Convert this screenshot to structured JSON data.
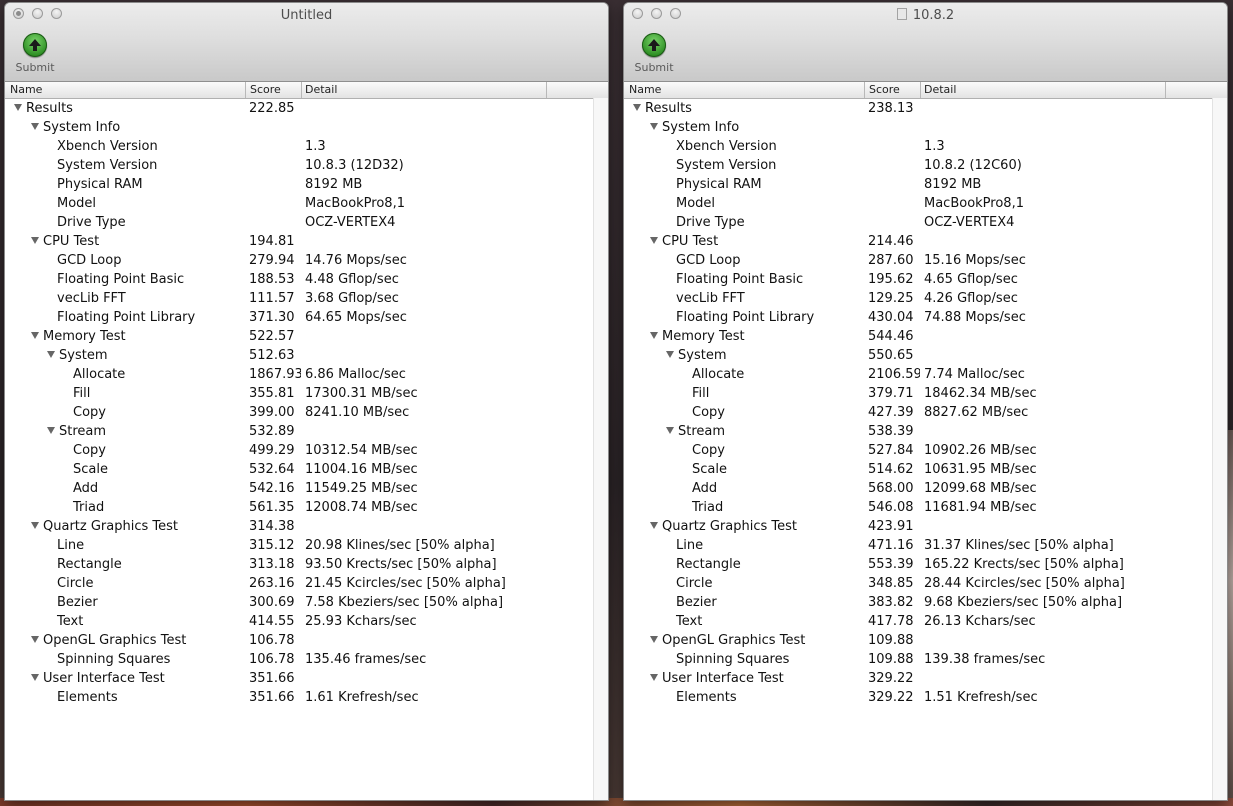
{
  "windows": [
    {
      "title": "Untitled",
      "has_doc_icon": false,
      "submit_label": "Submit",
      "columns": [
        "Name",
        "Score",
        "Detail"
      ],
      "rows": [
        {
          "level": 0,
          "name": "Results",
          "score": "222.85",
          "detail": "",
          "disclosure": true
        },
        {
          "level": 1,
          "name": "System Info",
          "score": "",
          "detail": "",
          "disclosure": true
        },
        {
          "level": 2,
          "name": "Xbench Version",
          "score": "",
          "detail": "1.3",
          "disclosure": false
        },
        {
          "level": 2,
          "name": "System Version",
          "score": "",
          "detail": "10.8.3 (12D32)",
          "disclosure": false
        },
        {
          "level": 2,
          "name": "Physical RAM",
          "score": "",
          "detail": "8192 MB",
          "disclosure": false
        },
        {
          "level": 2,
          "name": "Model",
          "score": "",
          "detail": "MacBookPro8,1",
          "disclosure": false
        },
        {
          "level": 2,
          "name": "Drive Type",
          "score": "",
          "detail": "OCZ-VERTEX4",
          "disclosure": false
        },
        {
          "level": 1,
          "name": "CPU Test",
          "score": "194.81",
          "detail": "",
          "disclosure": true
        },
        {
          "level": 2,
          "name": "GCD Loop",
          "score": "279.94",
          "detail": "14.76 Mops/sec",
          "disclosure": false
        },
        {
          "level": 2,
          "name": "Floating Point Basic",
          "score": "188.53",
          "detail": "4.48 Gflop/sec",
          "disclosure": false
        },
        {
          "level": 2,
          "name": "vecLib FFT",
          "score": "111.57",
          "detail": "3.68 Gflop/sec",
          "disclosure": false
        },
        {
          "level": 2,
          "name": "Floating Point Library",
          "score": "371.30",
          "detail": "64.65 Mops/sec",
          "disclosure": false
        },
        {
          "level": 1,
          "name": "Memory Test",
          "score": "522.57",
          "detail": "",
          "disclosure": true
        },
        {
          "level": 2,
          "name": "System",
          "score": "512.63",
          "detail": "",
          "disclosure": true
        },
        {
          "level": 3,
          "name": "Allocate",
          "score": "1867.93",
          "detail": "6.86 Malloc/sec",
          "disclosure": false
        },
        {
          "level": 3,
          "name": "Fill",
          "score": "355.81",
          "detail": "17300.31 MB/sec",
          "disclosure": false
        },
        {
          "level": 3,
          "name": "Copy",
          "score": "399.00",
          "detail": "8241.10 MB/sec",
          "disclosure": false
        },
        {
          "level": 2,
          "name": "Stream",
          "score": "532.89",
          "detail": "",
          "disclosure": true
        },
        {
          "level": 3,
          "name": "Copy",
          "score": "499.29",
          "detail": "10312.54 MB/sec",
          "disclosure": false
        },
        {
          "level": 3,
          "name": "Scale",
          "score": "532.64",
          "detail": "11004.16 MB/sec",
          "disclosure": false
        },
        {
          "level": 3,
          "name": "Add",
          "score": "542.16",
          "detail": "11549.25 MB/sec",
          "disclosure": false
        },
        {
          "level": 3,
          "name": "Triad",
          "score": "561.35",
          "detail": "12008.74 MB/sec",
          "disclosure": false
        },
        {
          "level": 1,
          "name": "Quartz Graphics Test",
          "score": "314.38",
          "detail": "",
          "disclosure": true
        },
        {
          "level": 2,
          "name": "Line",
          "score": "315.12",
          "detail": "20.98 Klines/sec [50% alpha]",
          "disclosure": false
        },
        {
          "level": 2,
          "name": "Rectangle",
          "score": "313.18",
          "detail": "93.50 Krects/sec [50% alpha]",
          "disclosure": false
        },
        {
          "level": 2,
          "name": "Circle",
          "score": "263.16",
          "detail": "21.45 Kcircles/sec [50% alpha]",
          "disclosure": false
        },
        {
          "level": 2,
          "name": "Bezier",
          "score": "300.69",
          "detail": "7.58 Kbeziers/sec [50% alpha]",
          "disclosure": false
        },
        {
          "level": 2,
          "name": "Text",
          "score": "414.55",
          "detail": "25.93 Kchars/sec",
          "disclosure": false
        },
        {
          "level": 1,
          "name": "OpenGL Graphics Test",
          "score": "106.78",
          "detail": "",
          "disclosure": true
        },
        {
          "level": 2,
          "name": "Spinning Squares",
          "score": "106.78",
          "detail": "135.46 frames/sec",
          "disclosure": false
        },
        {
          "level": 1,
          "name": "User Interface Test",
          "score": "351.66",
          "detail": "",
          "disclosure": true
        },
        {
          "level": 2,
          "name": "Elements",
          "score": "351.66",
          "detail": "1.61 Krefresh/sec",
          "disclosure": false
        }
      ]
    },
    {
      "title": "10.8.2",
      "has_doc_icon": true,
      "submit_label": "Submit",
      "columns": [
        "Name",
        "Score",
        "Detail"
      ],
      "rows": [
        {
          "level": 0,
          "name": "Results",
          "score": "238.13",
          "detail": "",
          "disclosure": true
        },
        {
          "level": 1,
          "name": "System Info",
          "score": "",
          "detail": "",
          "disclosure": true
        },
        {
          "level": 2,
          "name": "Xbench Version",
          "score": "",
          "detail": "1.3",
          "disclosure": false
        },
        {
          "level": 2,
          "name": "System Version",
          "score": "",
          "detail": "10.8.2 (12C60)",
          "disclosure": false
        },
        {
          "level": 2,
          "name": "Physical RAM",
          "score": "",
          "detail": "8192 MB",
          "disclosure": false
        },
        {
          "level": 2,
          "name": "Model",
          "score": "",
          "detail": "MacBookPro8,1",
          "disclosure": false
        },
        {
          "level": 2,
          "name": "Drive Type",
          "score": "",
          "detail": "OCZ-VERTEX4",
          "disclosure": false
        },
        {
          "level": 1,
          "name": "CPU Test",
          "score": "214.46",
          "detail": "",
          "disclosure": true
        },
        {
          "level": 2,
          "name": "GCD Loop",
          "score": "287.60",
          "detail": "15.16 Mops/sec",
          "disclosure": false
        },
        {
          "level": 2,
          "name": "Floating Point Basic",
          "score": "195.62",
          "detail": "4.65 Gflop/sec",
          "disclosure": false
        },
        {
          "level": 2,
          "name": "vecLib FFT",
          "score": "129.25",
          "detail": "4.26 Gflop/sec",
          "disclosure": false
        },
        {
          "level": 2,
          "name": "Floating Point Library",
          "score": "430.04",
          "detail": "74.88 Mops/sec",
          "disclosure": false
        },
        {
          "level": 1,
          "name": "Memory Test",
          "score": "544.46",
          "detail": "",
          "disclosure": true
        },
        {
          "level": 2,
          "name": "System",
          "score": "550.65",
          "detail": "",
          "disclosure": true
        },
        {
          "level": 3,
          "name": "Allocate",
          "score": "2106.59",
          "detail": "7.74 Malloc/sec",
          "disclosure": false
        },
        {
          "level": 3,
          "name": "Fill",
          "score": "379.71",
          "detail": "18462.34 MB/sec",
          "disclosure": false
        },
        {
          "level": 3,
          "name": "Copy",
          "score": "427.39",
          "detail": "8827.62 MB/sec",
          "disclosure": false
        },
        {
          "level": 2,
          "name": "Stream",
          "score": "538.39",
          "detail": "",
          "disclosure": true
        },
        {
          "level": 3,
          "name": "Copy",
          "score": "527.84",
          "detail": "10902.26 MB/sec",
          "disclosure": false
        },
        {
          "level": 3,
          "name": "Scale",
          "score": "514.62",
          "detail": "10631.95 MB/sec",
          "disclosure": false
        },
        {
          "level": 3,
          "name": "Add",
          "score": "568.00",
          "detail": "12099.68 MB/sec",
          "disclosure": false
        },
        {
          "level": 3,
          "name": "Triad",
          "score": "546.08",
          "detail": "11681.94 MB/sec",
          "disclosure": false
        },
        {
          "level": 1,
          "name": "Quartz Graphics Test",
          "score": "423.91",
          "detail": "",
          "disclosure": true
        },
        {
          "level": 2,
          "name": "Line",
          "score": "471.16",
          "detail": "31.37 Klines/sec [50% alpha]",
          "disclosure": false
        },
        {
          "level": 2,
          "name": "Rectangle",
          "score": "553.39",
          "detail": "165.22 Krects/sec [50% alpha]",
          "disclosure": false
        },
        {
          "level": 2,
          "name": "Circle",
          "score": "348.85",
          "detail": "28.44 Kcircles/sec [50% alpha]",
          "disclosure": false
        },
        {
          "level": 2,
          "name": "Bezier",
          "score": "383.82",
          "detail": "9.68 Kbeziers/sec [50% alpha]",
          "disclosure": false
        },
        {
          "level": 2,
          "name": "Text",
          "score": "417.78",
          "detail": "26.13 Kchars/sec",
          "disclosure": false
        },
        {
          "level": 1,
          "name": "OpenGL Graphics Test",
          "score": "109.88",
          "detail": "",
          "disclosure": true
        },
        {
          "level": 2,
          "name": "Spinning Squares",
          "score": "109.88",
          "detail": "139.38 frames/sec",
          "disclosure": false
        },
        {
          "level": 1,
          "name": "User Interface Test",
          "score": "329.22",
          "detail": "",
          "disclosure": true
        },
        {
          "level": 2,
          "name": "Elements",
          "score": "329.22",
          "detail": "1.51 Krefresh/sec",
          "disclosure": false
        }
      ]
    }
  ]
}
